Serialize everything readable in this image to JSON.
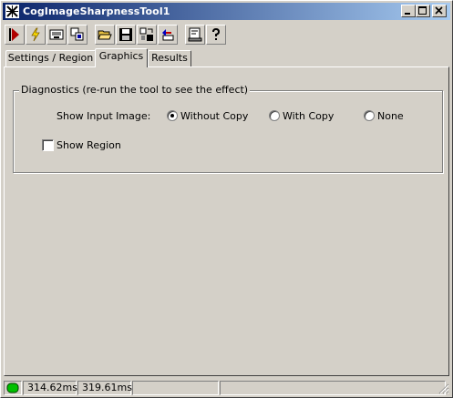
{
  "window": {
    "title": "CogImageSharpnessTool1",
    "title_gradient": [
      "#0a246a",
      "#a6caf0"
    ]
  },
  "toolbar": {
    "buttons": [
      {
        "name": "run-icon"
      },
      {
        "name": "lightning-icon"
      },
      {
        "name": "display-icon"
      },
      {
        "name": "copy-icon"
      },
      {
        "name": "open-folder-icon"
      },
      {
        "name": "save-disk-icon"
      },
      {
        "name": "export-icon"
      },
      {
        "name": "undo-icon"
      },
      {
        "name": "properties-icon"
      },
      {
        "name": "help-icon"
      }
    ]
  },
  "tabs": [
    {
      "label": "Settings / Region"
    },
    {
      "label": "Graphics",
      "active": true
    },
    {
      "label": "Results"
    }
  ],
  "diagnostics": {
    "group_label": "Diagnostics (re-run the tool to see the effect)",
    "show_input_label": "Show Input Image:",
    "options": [
      {
        "label": "Without Copy",
        "selected": true
      },
      {
        "label": "With Copy",
        "selected": false
      },
      {
        "label": "None",
        "selected": false
      }
    ],
    "show_region_label": "Show Region",
    "show_region_checked": false
  },
  "status": {
    "indicator_color": "#00c000",
    "time1": "314.62ms",
    "time2": "319.61ms"
  }
}
